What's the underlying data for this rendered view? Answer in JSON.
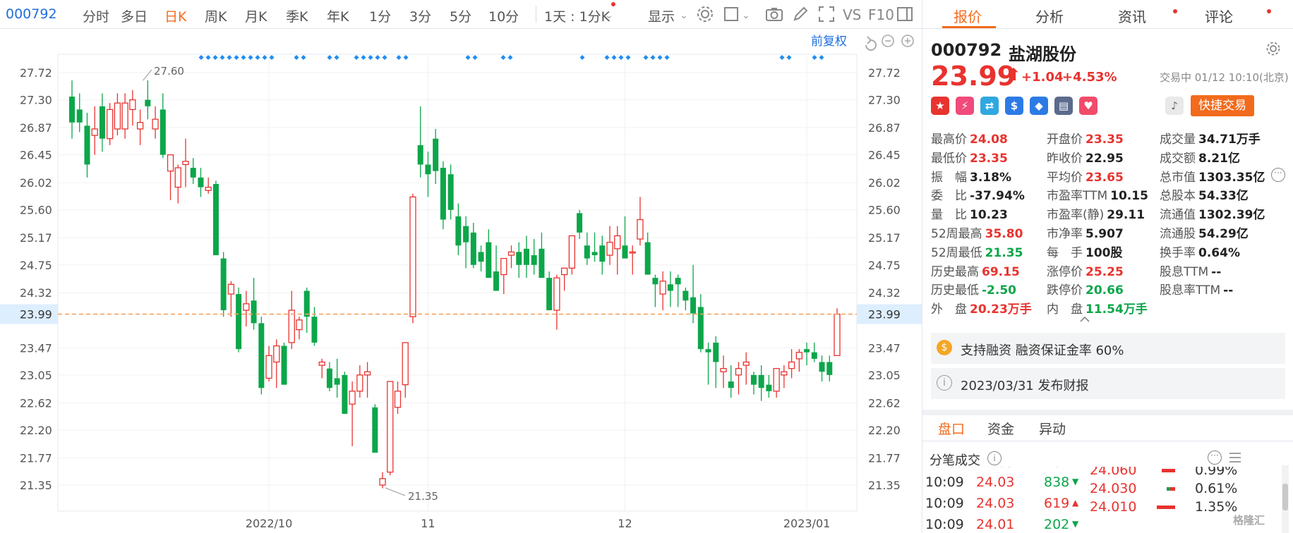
{
  "toolbar": {
    "code": "000792",
    "tabs": [
      "分时",
      "多日",
      "日K",
      "周K",
      "月K",
      "季K",
      "年K",
      "1分",
      "3分",
      "5分",
      "10分"
    ],
    "multi_period": "1天 : 1分K",
    "display": "显示",
    "vs": "VS",
    "f10": "F10"
  },
  "chart": {
    "adjust_label": "前复权",
    "left_axis": [
      "27.72",
      "27.30",
      "26.87",
      "26.45",
      "26.02",
      "25.60",
      "25.17",
      "24.75",
      "24.32",
      "23.99",
      "23.47",
      "23.05",
      "22.62",
      "22.20",
      "21.77",
      "21.35"
    ],
    "right_axis": [
      "27.72",
      "27.30",
      "26.87",
      "26.45",
      "26.02",
      "25.60",
      "25.17",
      "24.75",
      "24.32",
      "23.99",
      "23.47",
      "23.05",
      "22.62",
      "22.20",
      "21.77",
      "21.35"
    ],
    "x_labels": [
      "2022/10",
      "11",
      "12",
      "2023/01"
    ],
    "high_annotation": "27.60",
    "low_annotation": "21.35",
    "current_price_label": "23.99",
    "colors": {
      "up": "#e8332f",
      "down": "#0ca64a",
      "marker": "#1f8ef1",
      "price_line": "#f5a25d"
    }
  },
  "chart_data": {
    "type": "candlestick",
    "ylim": [
      21.1,
      28.0
    ],
    "current_price": 23.99,
    "period_high": 27.6,
    "period_low": 21.35,
    "x_labels": [
      "2022/10",
      "11",
      "12",
      "2023/01"
    ],
    "candles": [
      [
        27.35,
        27.6,
        26.7,
        26.95
      ],
      [
        27.15,
        27.4,
        26.8,
        26.95
      ],
      [
        26.9,
        27.1,
        26.1,
        26.3
      ],
      [
        26.75,
        27.2,
        26.45,
        26.85
      ],
      [
        27.2,
        27.4,
        26.5,
        26.7
      ],
      [
        26.7,
        27.25,
        26.6,
        27.15
      ],
      [
        26.85,
        27.4,
        26.75,
        27.25
      ],
      [
        26.85,
        27.4,
        26.7,
        27.25
      ],
      [
        27.15,
        27.45,
        26.9,
        27.3
      ],
      [
        26.85,
        27.15,
        26.6,
        26.95
      ],
      [
        27.3,
        27.6,
        27.0,
        27.2
      ],
      [
        26.85,
        27.2,
        26.7,
        27.0
      ],
      [
        27.15,
        27.4,
        26.4,
        26.45
      ],
      [
        26.2,
        26.45,
        25.75,
        26.45
      ],
      [
        25.95,
        26.3,
        25.7,
        26.25
      ],
      [
        26.3,
        26.7,
        25.95,
        26.35
      ],
      [
        26.25,
        26.4,
        26.0,
        26.1
      ],
      [
        26.1,
        26.25,
        25.8,
        25.95
      ],
      [
        25.9,
        26.1,
        25.85,
        25.95
      ],
      [
        26.0,
        26.05,
        24.9,
        24.9
      ],
      [
        24.85,
        24.95,
        23.95,
        24.05
      ],
      [
        24.3,
        24.5,
        23.95,
        24.45
      ],
      [
        24.3,
        24.4,
        23.4,
        23.45
      ],
      [
        24.05,
        24.35,
        23.8,
        24.15
      ],
      [
        24.2,
        24.55,
        23.75,
        23.85
      ],
      [
        23.85,
        23.95,
        22.75,
        22.85
      ],
      [
        23.0,
        23.5,
        22.95,
        23.35
      ],
      [
        23.25,
        23.6,
        22.85,
        23.5
      ],
      [
        23.5,
        23.55,
        22.95,
        22.9
      ],
      [
        23.55,
        24.35,
        23.45,
        24.05
      ],
      [
        23.75,
        23.95,
        23.6,
        23.9
      ],
      [
        24.35,
        24.4,
        23.7,
        23.95
      ],
      [
        23.95,
        24.1,
        23.5,
        23.55
      ],
      [
        23.2,
        23.3,
        23.0,
        23.25
      ],
      [
        23.15,
        23.25,
        22.8,
        22.85
      ],
      [
        23.0,
        23.3,
        22.7,
        22.9
      ],
      [
        23.05,
        23.1,
        22.45,
        22.45
      ],
      [
        22.6,
        22.95,
        21.95,
        22.8
      ],
      [
        22.8,
        23.2,
        22.7,
        23.05
      ],
      [
        23.05,
        23.25,
        22.7,
        23.1
      ],
      [
        22.55,
        22.6,
        21.85,
        21.85
      ],
      [
        21.35,
        21.55,
        21.3,
        21.45
      ],
      [
        21.55,
        22.95,
        21.5,
        22.95
      ],
      [
        22.55,
        22.95,
        22.45,
        22.8
      ],
      [
        22.9,
        23.55,
        22.7,
        23.55
      ],
      [
        23.95,
        25.85,
        23.85,
        25.8
      ],
      [
        26.6,
        27.2,
        26.1,
        26.3
      ],
      [
        26.3,
        26.5,
        25.8,
        26.15
      ],
      [
        26.7,
        26.85,
        26.0,
        26.2
      ],
      [
        26.25,
        26.35,
        25.3,
        25.45
      ],
      [
        26.15,
        26.3,
        25.45,
        25.6
      ],
      [
        25.5,
        25.7,
        24.9,
        25.05
      ],
      [
        25.35,
        25.5,
        24.7,
        25.1
      ],
      [
        25.25,
        25.4,
        24.7,
        24.75
      ],
      [
        24.95,
        25.05,
        24.65,
        24.8
      ],
      [
        25.1,
        25.3,
        24.55,
        24.55
      ],
      [
        24.65,
        25.05,
        24.35,
        24.35
      ],
      [
        24.6,
        24.85,
        24.3,
        24.85
      ],
      [
        24.9,
        25.05,
        24.7,
        24.95
      ],
      [
        24.95,
        25.1,
        24.55,
        24.75
      ],
      [
        25.0,
        25.2,
        24.55,
        24.75
      ],
      [
        24.9,
        25.15,
        24.6,
        24.75
      ],
      [
        25.0,
        25.25,
        24.75,
        24.55
      ],
      [
        24.55,
        24.65,
        24.05,
        24.05
      ],
      [
        24.05,
        24.6,
        23.75,
        24.55
      ],
      [
        24.6,
        24.7,
        24.35,
        24.7
      ],
      [
        24.7,
        25.2,
        24.6,
        25.2
      ],
      [
        25.55,
        25.6,
        25.15,
        25.25
      ],
      [
        25.05,
        25.25,
        24.75,
        24.85
      ],
      [
        24.95,
        25.25,
        24.8,
        24.9
      ],
      [
        25.05,
        25.2,
        24.6,
        24.8
      ],
      [
        24.9,
        25.35,
        24.75,
        25.1
      ],
      [
        25.0,
        25.35,
        24.6,
        25.2
      ],
      [
        25.05,
        25.5,
        24.95,
        24.85
      ],
      [
        24.95,
        25.05,
        24.6,
        24.95
      ],
      [
        25.15,
        25.8,
        25.05,
        25.45
      ],
      [
        25.1,
        25.25,
        24.6,
        24.6
      ],
      [
        24.55,
        24.6,
        24.1,
        24.45
      ],
      [
        24.3,
        24.65,
        24.05,
        24.5
      ],
      [
        24.45,
        24.65,
        24.1,
        24.35
      ],
      [
        24.55,
        24.6,
        24.1,
        24.45
      ],
      [
        24.35,
        24.4,
        24.05,
        24.2
      ],
      [
        24.25,
        24.75,
        23.85,
        24.0
      ],
      [
        24.1,
        24.3,
        23.4,
        23.45
      ],
      [
        23.45,
        23.55,
        22.9,
        23.4
      ],
      [
        23.55,
        23.65,
        22.85,
        23.25
      ],
      [
        23.1,
        23.35,
        22.85,
        23.15
      ],
      [
        22.95,
        23.2,
        22.7,
        22.85
      ],
      [
        23.05,
        23.25,
        22.75,
        23.15
      ],
      [
        23.2,
        23.4,
        22.9,
        23.25
      ],
      [
        23.05,
        23.1,
        22.75,
        22.9
      ],
      [
        23.05,
        23.2,
        22.65,
        22.85
      ],
      [
        22.9,
        23.05,
        22.7,
        22.8
      ],
      [
        22.8,
        23.15,
        22.7,
        23.15
      ],
      [
        23.05,
        23.2,
        22.85,
        23.1
      ],
      [
        23.15,
        23.45,
        23.0,
        23.25
      ],
      [
        23.3,
        23.45,
        23.1,
        23.4
      ],
      [
        23.45,
        23.55,
        23.2,
        23.4
      ],
      [
        23.4,
        23.55,
        23.25,
        23.3
      ],
      [
        23.25,
        23.35,
        22.95,
        23.1
      ],
      [
        23.25,
        23.35,
        22.95,
        23.05
      ],
      [
        23.35,
        24.08,
        23.35,
        23.99
      ]
    ]
  },
  "panel": {
    "tabs": [
      "报价",
      "分析",
      "资讯",
      "评论"
    ],
    "stock_code": "000792",
    "stock_name": "盐湖股份",
    "price": "23.99",
    "arrow": "⬆",
    "change": "+1.04",
    "change_pct": "+4.53%",
    "trade_status": "交易中 01/12 10:10(北京)",
    "fast_trade": "快捷交易",
    "stats": [
      [
        {
          "k": "最高价",
          "v": "24.08",
          "c": "red"
        },
        {
          "k": "开盘价",
          "v": "23.35",
          "c": "red"
        },
        {
          "k": "成交量",
          "v": "34.71万手",
          "c": "dark"
        }
      ],
      [
        {
          "k": "最低价",
          "v": "23.35",
          "c": "red"
        },
        {
          "k": "昨收价",
          "v": "22.95",
          "c": "dark"
        },
        {
          "k": "成交额",
          "v": "8.21亿",
          "c": "dark"
        }
      ],
      [
        {
          "k": "振　幅",
          "v": "3.18%",
          "c": "dark"
        },
        {
          "k": "平均价",
          "v": "23.65",
          "c": "red"
        },
        {
          "k": "总市值",
          "v": "1303.35亿",
          "c": "dark"
        }
      ],
      [
        {
          "k": "委　比",
          "v": "-37.94%",
          "c": "dark"
        },
        {
          "k": "市盈率TTM",
          "v": "10.15",
          "c": "dark"
        },
        {
          "k": "总股本",
          "v": "54.33亿",
          "c": "dark"
        }
      ],
      [
        {
          "k": "量　比",
          "v": "10.23",
          "c": "dark"
        },
        {
          "k": "市盈率(静)",
          "v": "29.11",
          "c": "dark"
        },
        {
          "k": "流通值",
          "v": "1302.39亿",
          "c": "dark"
        }
      ],
      [
        {
          "k": "52周最高",
          "v": "35.80",
          "c": "red"
        },
        {
          "k": "市净率",
          "v": "5.907",
          "c": "dark"
        },
        {
          "k": "流通股",
          "v": "54.29亿",
          "c": "dark"
        }
      ],
      [
        {
          "k": "52周最低",
          "v": "21.35",
          "c": "green"
        },
        {
          "k": "每　手",
          "v": "100股",
          "c": "dark"
        },
        {
          "k": "换手率",
          "v": "0.64%",
          "c": "dark"
        }
      ],
      [
        {
          "k": "历史最高",
          "v": "69.15",
          "c": "red"
        },
        {
          "k": "涨停价",
          "v": "25.25",
          "c": "red"
        },
        {
          "k": "股息TTM",
          "v": "--",
          "c": "dark"
        }
      ],
      [
        {
          "k": "历史最低",
          "v": "-2.50",
          "c": "green"
        },
        {
          "k": "跌停价",
          "v": "20.66",
          "c": "green"
        },
        {
          "k": "股息率TTM",
          "v": "--",
          "c": "dark"
        }
      ],
      [
        {
          "k": "外　盘",
          "v": "20.23万手",
          "c": "red"
        },
        {
          "k": "内　盘",
          "v": "11.54万手",
          "c": "green"
        }
      ]
    ],
    "info_margin": "支持融资 融资保证金率 60%",
    "info_report": "2023/03/31  发布财报",
    "bottom_tabs": [
      "盘口",
      "资金",
      "异动"
    ],
    "ticks_title": "分笔成交",
    "ticks": [
      {
        "time": "10:09",
        "price": "24.03",
        "vol": "838",
        "dir": "down"
      },
      {
        "time": "10:09",
        "price": "24.03",
        "vol": "619",
        "dir": "up"
      },
      {
        "time": "10:09",
        "price": "24.01",
        "vol": "202",
        "dir": "down"
      }
    ],
    "levels": [
      {
        "price": "24.060",
        "pct": "0.99%",
        "frac": 0.55
      },
      {
        "price": "24.030",
        "pct": "0.61%",
        "frac": 0.35
      },
      {
        "price": "24.010",
        "pct": "1.35%",
        "frac": 0.75
      }
    ],
    "watermark": "格隆汇"
  }
}
